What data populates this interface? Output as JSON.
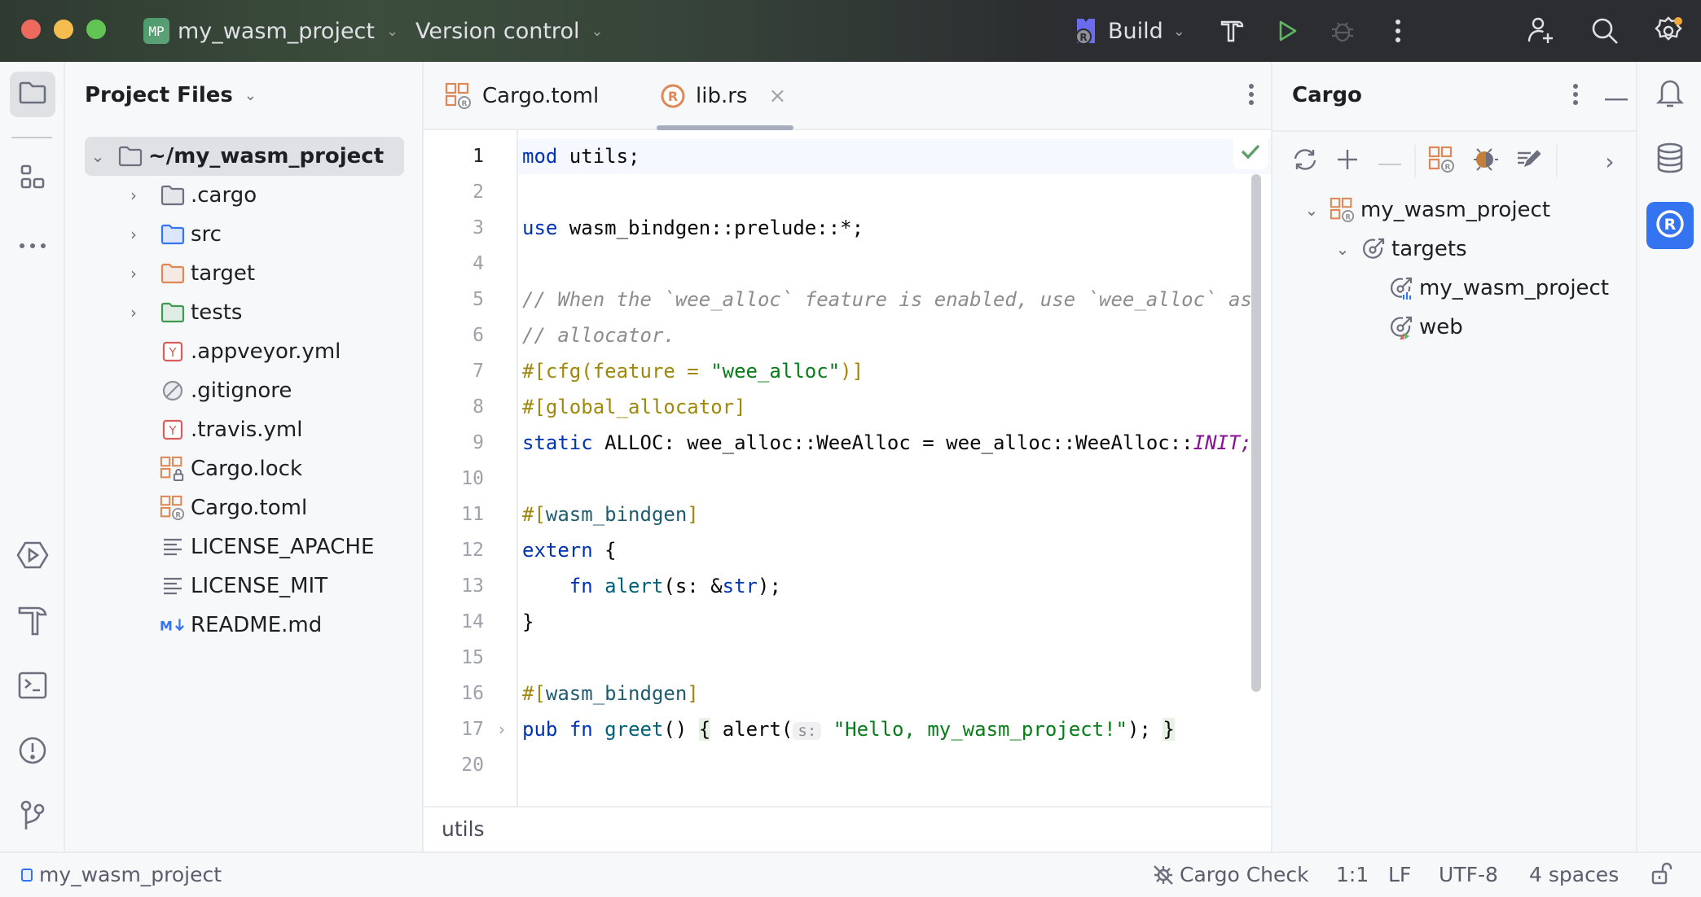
{
  "titlebar": {
    "project_badge": "MP",
    "project_name": "my_wasm_project",
    "vcs_label": "Version control",
    "run_config": "Build",
    "icons": [
      "hammer-icon",
      "run-icon",
      "debug-icon",
      "more-icon",
      "add-user-icon",
      "search-icon",
      "settings-icon"
    ]
  },
  "left_strip": {
    "top": [
      "folder-icon",
      "structure-icon",
      "more-icon"
    ],
    "bottom": [
      "run-icon",
      "build-icon",
      "terminal-icon",
      "problems-icon",
      "git-icon"
    ]
  },
  "project_panel": {
    "title": "Project Files",
    "root": "~/my_wasm_project",
    "items": [
      {
        "label": ".cargo",
        "type": "folder",
        "color": "#6c707e"
      },
      {
        "label": "src",
        "type": "folder",
        "color": "#3574f0"
      },
      {
        "label": "target",
        "type": "folder",
        "color": "#e08855"
      },
      {
        "label": "tests",
        "type": "folder",
        "color": "#3d9a50"
      },
      {
        "label": ".appveyor.yml",
        "type": "yaml"
      },
      {
        "label": ".gitignore",
        "type": "ignore"
      },
      {
        "label": ".travis.yml",
        "type": "yaml"
      },
      {
        "label": "Cargo.lock",
        "type": "cargo-lock"
      },
      {
        "label": "Cargo.toml",
        "type": "cargo"
      },
      {
        "label": "LICENSE_APACHE",
        "type": "text"
      },
      {
        "label": "LICENSE_MIT",
        "type": "text"
      },
      {
        "label": "README.md",
        "type": "markdown"
      }
    ]
  },
  "editor": {
    "tabs": [
      {
        "label": "Cargo.toml",
        "active": false
      },
      {
        "label": "lib.rs",
        "active": true
      }
    ],
    "line_numbers": [
      "1",
      "2",
      "3",
      "4",
      "5",
      "6",
      "7",
      "8",
      "9",
      "10",
      "11",
      "12",
      "13",
      "14",
      "15",
      "16",
      "17",
      "20"
    ],
    "lines": {
      "l1": {
        "kw": "mod",
        "rest": " utils;"
      },
      "l3": {
        "kw": "use",
        "rest": " wasm_bindgen::prelude::*;"
      },
      "l5": "// When the `wee_alloc` feature is enabled, use `wee_alloc` as the global",
      "l6": "// allocator.",
      "l7": {
        "pre": "#[cfg(feature = ",
        "str": "\"wee_alloc\"",
        "post": ")]"
      },
      "l8": "#[global_allocator]",
      "l9": {
        "kw": "static",
        "rest": " ALLOC: wee_alloc::WeeAlloc = wee_alloc::WeeAlloc::",
        "const": "INIT;"
      },
      "l11": {
        "hash": "#[",
        "name": "wasm_bindgen",
        "close": "]"
      },
      "l12": {
        "kw": "extern",
        "rest": " {"
      },
      "l13": {
        "indent": "    ",
        "kw": "fn",
        "sp": " ",
        "fn": "alert",
        "pre": "(s: &",
        "ty": "str",
        "post": ");"
      },
      "l14": "}",
      "l16": {
        "hash": "#[",
        "name": "wasm_bindgen",
        "close": "]"
      },
      "l17": {
        "kw1": "pub",
        "kw2": "fn",
        "fn": "greet",
        "parens": "()",
        "open": "{",
        "call": "alert(",
        "hint": "s:",
        "str": "\"Hello, my_wasm_project!\"",
        "end": ");",
        "close": "}"
      }
    },
    "breadcrumb": "utils",
    "inspection_status": "ok"
  },
  "cargo_panel": {
    "title": "Cargo",
    "toolbar": [
      "refresh-icon",
      "add-icon",
      "remove-icon",
      "cargo-icon",
      "debug-icon",
      "edit-icon",
      "expand-icon"
    ],
    "tree": {
      "project": "my_wasm_project",
      "targets_label": "targets",
      "targets": [
        "my_wasm_project",
        "web"
      ]
    }
  },
  "right_strip": [
    "notifications-icon",
    "database-icon",
    "rust-icon"
  ],
  "statusbar": {
    "project": "my_wasm_project",
    "cargo_check": "Cargo Check",
    "position": "1:1",
    "line_sep": "LF",
    "encoding": "UTF-8",
    "indent": "4 spaces"
  },
  "colors": {
    "accent": "#3574f0",
    "run_green": "#5fb865",
    "rust_orange": "#e08855"
  }
}
